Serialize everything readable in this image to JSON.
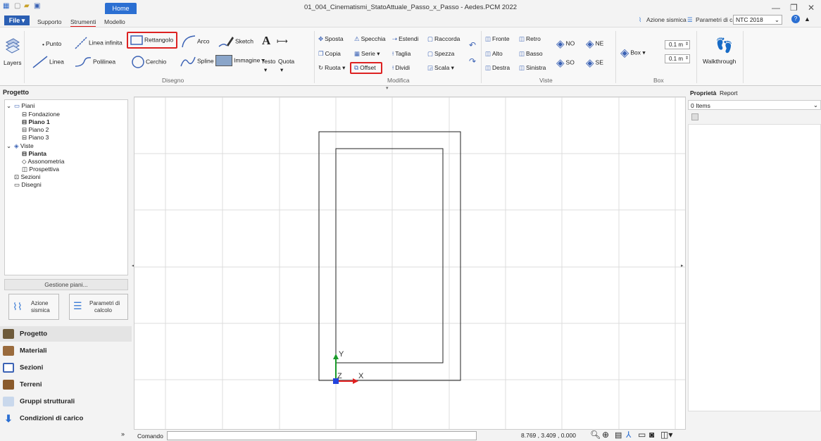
{
  "titlebar": {
    "title": "01_004_Cinematismi_StatoAttuale_Passo_x_Passo - Aedes.PCM 2022",
    "home_tab": "Home",
    "minimize": "—",
    "restore": "❐",
    "close": "✕"
  },
  "tabs": {
    "file": "File ▾",
    "supporto": "Supporto",
    "strumenti": "Strumenti",
    "modello": "Modello"
  },
  "topright": {
    "azione_sismica": "Azione sismica",
    "parametri_calcolo": "Parametri di calcolo",
    "ntc": "NTC 2018",
    "help": "?"
  },
  "ribbon": {
    "layers": "Layers",
    "punto": "Punto",
    "linea_infinita": "Linea infinita",
    "rettangolo": "Rettangolo",
    "arco": "Arco",
    "sketch": "Sketch",
    "testo": "Testo",
    "quota": "Quota",
    "linea": "Linea",
    "polilinea": "Polilinea",
    "cerchio": "Cerchio",
    "spline": "Spline",
    "immagine": "Immagine ▾",
    "group_disegno": "Disegno",
    "sposta": "Sposta",
    "specchia": "Specchia",
    "estendi": "Estendi",
    "raccorda": "Raccorda",
    "copia": "Copia",
    "serie": "Serie ▾",
    "taglia": "Taglia",
    "spezza": "Spezza",
    "ruota": "Ruota ▾",
    "offset": "Offset",
    "dividi": "Dividi",
    "scala": "Scala ▾",
    "group_modifica": "Modifica",
    "fronte": "Fronte",
    "retro": "Retro",
    "alto": "Alto",
    "basso": "Basso",
    "destra": "Destra",
    "sinistra": "Sinistra",
    "no": "NO",
    "ne": "NE",
    "so": "SO",
    "se": "SE",
    "group_viste": "Viste",
    "box": "Box ▾",
    "box_val1": "0.1 m",
    "box_val2": "0.1 m",
    "group_box": "Box",
    "walkthrough": "Walkthrough"
  },
  "left": {
    "header": "Progetto",
    "tree": {
      "piani": "Piani",
      "fondazione": "Fondazione",
      "piano1": "Piano 1",
      "piano2": "Piano 2",
      "piano3": "Piano 3",
      "viste": "Viste",
      "pianta": "Pianta",
      "assonometria": "Assonometria",
      "prospettiva": "Prospettiva",
      "sezioni": "Sezioni",
      "disegni": "Disegni"
    },
    "gestione_piani": "Gestione piani...",
    "azione_sismica_l1": "Azione",
    "azione_sismica_l2": "sismica",
    "parametri_l1": "Parametri di",
    "parametri_l2": "calcolo",
    "nav": {
      "progetto": "Progetto",
      "materiali": "Materiali",
      "sezioni": "Sezioni",
      "terreni": "Terreni",
      "gruppi": "Gruppi strutturali",
      "condizioni": "Condizioni di carico"
    }
  },
  "canvas": {
    "axis_y": "Y",
    "axis_z": "Z",
    "axis_x": "X"
  },
  "cmdbar": {
    "label": "Comando",
    "coords": "8.769 , 3.409 , 0.000"
  },
  "right": {
    "tab_proprieta": "Proprietà",
    "tab_report": "Report",
    "items": "0 Items"
  },
  "colors": {
    "accent": "#2b6fd2",
    "highlight": "#d22222"
  }
}
